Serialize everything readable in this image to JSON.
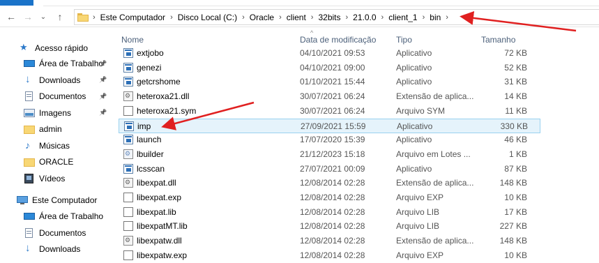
{
  "breadcrumb": [
    "Este Computador",
    "Disco Local (C:)",
    "Oracle",
    "client",
    "32bits",
    "21.0.0",
    "client_1",
    "bin"
  ],
  "nav": {
    "back": "←",
    "forward": "→",
    "recent": "⌄",
    "up": "↑"
  },
  "sidebar": {
    "quick_access": "Acesso rápido",
    "items": [
      {
        "label": "Área de Trabalho",
        "icon": "desktop-icon",
        "pinned": true
      },
      {
        "label": "Downloads",
        "icon": "download-icon",
        "pinned": true
      },
      {
        "label": "Documentos",
        "icon": "documents-icon",
        "pinned": true
      },
      {
        "label": "Imagens",
        "icon": "pictures-icon",
        "pinned": true
      },
      {
        "label": "admin",
        "icon": "folder-icon",
        "pinned": false
      },
      {
        "label": "Músicas",
        "icon": "music-icon",
        "pinned": false
      },
      {
        "label": "ORACLE",
        "icon": "folder-icon",
        "pinned": false
      },
      {
        "label": "Vídeos",
        "icon": "videos-icon",
        "pinned": false
      }
    ],
    "this_pc": "Este Computador",
    "pc_items": [
      {
        "label": "Área de Trabalho",
        "icon": "desktop-icon"
      },
      {
        "label": "Documentos",
        "icon": "documents-icon"
      },
      {
        "label": "Downloads",
        "icon": "download-icon"
      }
    ]
  },
  "columns": {
    "name": "Nome",
    "date": "Data de modificação",
    "type": "Tipo",
    "size": "Tamanho"
  },
  "files": [
    {
      "name": "extjobo",
      "date": "04/10/2021 09:53",
      "type": "Aplicativo",
      "size": "72 KB",
      "icon": "app"
    },
    {
      "name": "genezi",
      "date": "04/10/2021 09:00",
      "type": "Aplicativo",
      "size": "52 KB",
      "icon": "app"
    },
    {
      "name": "getcrshome",
      "date": "01/10/2021 15:44",
      "type": "Aplicativo",
      "size": "31 KB",
      "icon": "app"
    },
    {
      "name": "heteroxa21.dll",
      "date": "30/07/2021 06:24",
      "type": "Extensão de aplica...",
      "size": "14 KB",
      "icon": "dll"
    },
    {
      "name": "heteroxa21.sym",
      "date": "30/07/2021 06:24",
      "type": "Arquivo SYM",
      "size": "11 KB",
      "icon": "doc"
    },
    {
      "name": "imp",
      "date": "27/09/2021 15:59",
      "type": "Aplicativo",
      "size": "330 KB",
      "icon": "app",
      "selected": true
    },
    {
      "name": "launch",
      "date": "17/07/2020 15:39",
      "type": "Aplicativo",
      "size": "46 KB",
      "icon": "app"
    },
    {
      "name": "lbuilder",
      "date": "21/12/2023 15:18",
      "type": "Arquivo em Lotes ...",
      "size": "1 KB",
      "icon": "bat"
    },
    {
      "name": "lcsscan",
      "date": "27/07/2021 00:09",
      "type": "Aplicativo",
      "size": "87 KB",
      "icon": "app"
    },
    {
      "name": "libexpat.dll",
      "date": "12/08/2014 02:28",
      "type": "Extensão de aplica...",
      "size": "148 KB",
      "icon": "dll"
    },
    {
      "name": "libexpat.exp",
      "date": "12/08/2014 02:28",
      "type": "Arquivo EXP",
      "size": "10 KB",
      "icon": "doc"
    },
    {
      "name": "libexpat.lib",
      "date": "12/08/2014 02:28",
      "type": "Arquivo LIB",
      "size": "17 KB",
      "icon": "doc"
    },
    {
      "name": "libexpatMT.lib",
      "date": "12/08/2014 02:28",
      "type": "Arquivo LIB",
      "size": "227 KB",
      "icon": "doc"
    },
    {
      "name": "libexpatw.dll",
      "date": "12/08/2014 02:28",
      "type": "Extensão de aplica...",
      "size": "148 KB",
      "icon": "dll"
    },
    {
      "name": "libexpatw.exp",
      "date": "12/08/2014 02:28",
      "type": "Arquivo EXP",
      "size": "10 KB",
      "icon": "doc"
    }
  ],
  "colors": {
    "annotation_arrow": "#e02020",
    "selection_bg": "#e5f3fb",
    "selection_border": "#99d1ef",
    "folder": "#f8d775",
    "accent": "#1a73c9"
  }
}
